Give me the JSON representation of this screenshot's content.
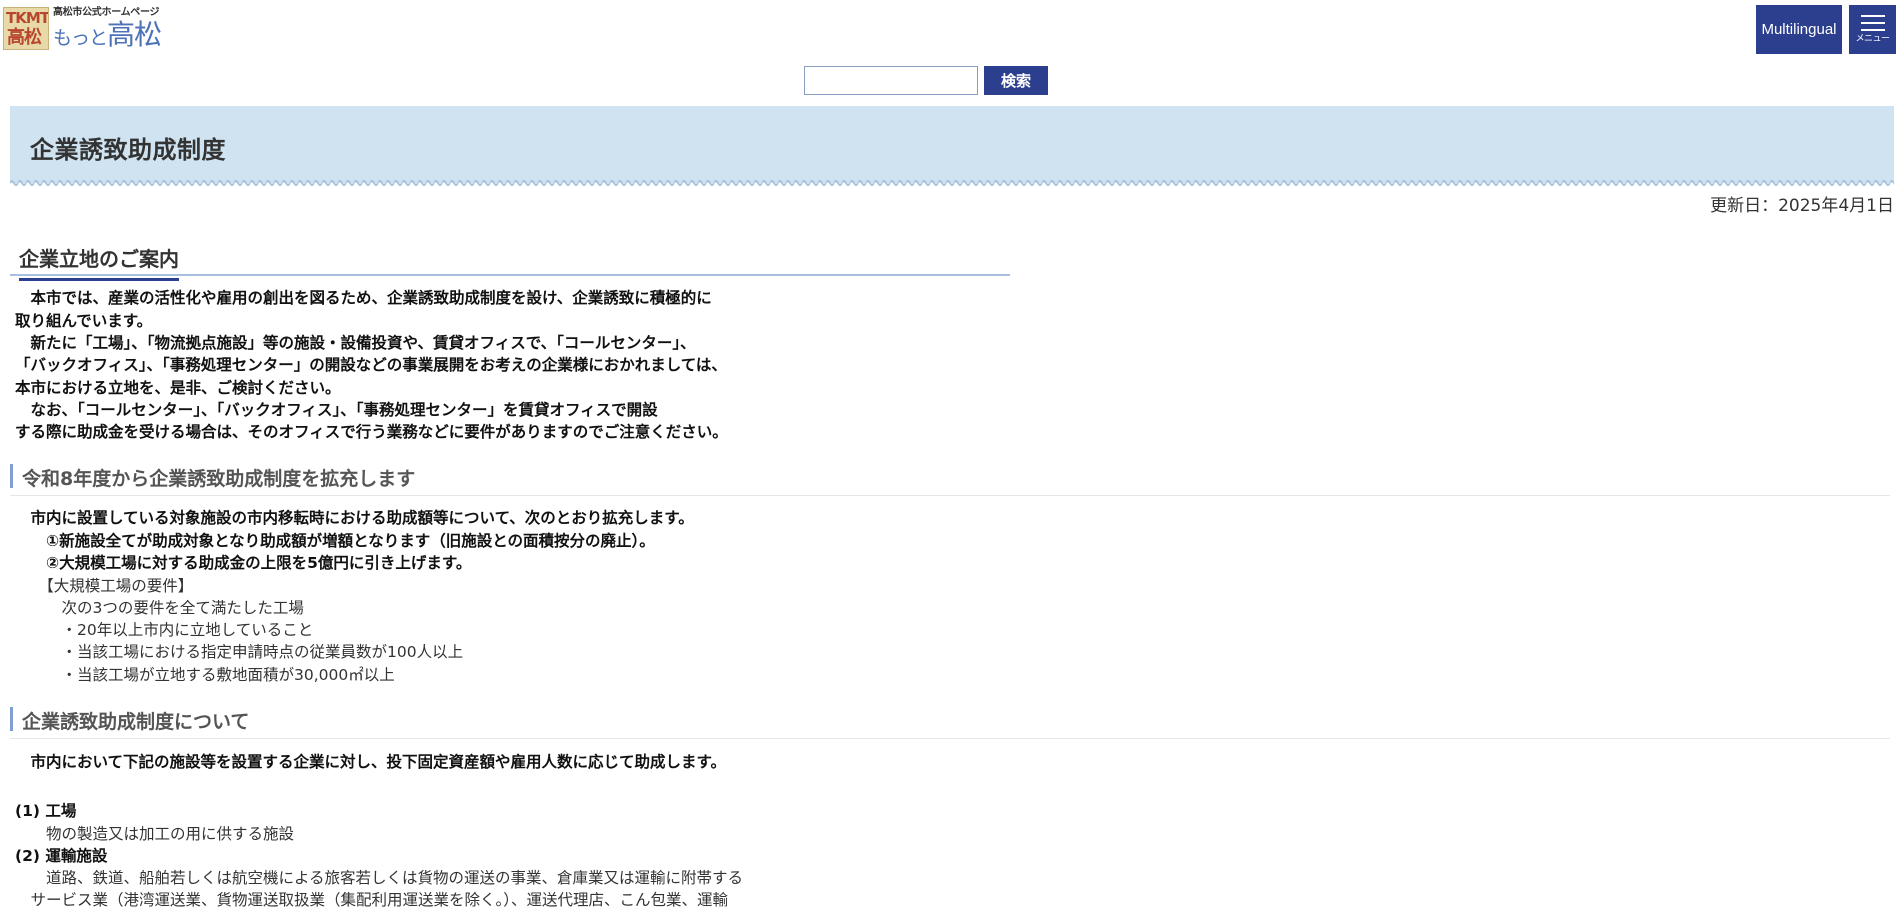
{
  "header": {
    "logo": {
      "mark_line1": "TKMT",
      "mark_line2": "高松",
      "subtitle": "高松市公式ホームページ",
      "title_small": "もっと",
      "title_large": "高松"
    },
    "multilingual_label": "Multilingual",
    "menu_label": "メニュー"
  },
  "search": {
    "placeholder": "",
    "button_label": "検索"
  },
  "page": {
    "title": "企業誘致助成制度",
    "updated": "更新日：2025年4月1日"
  },
  "section_intro": {
    "heading": "企業立地のご案内",
    "lines": [
      "　本市では、産業の活性化や雇用の創出を図るため、企業誘致助成制度を設け、企業誘致に積極的に",
      "取り組んでいます。",
      "　新たに「工場」、「物流拠点施設」等の施設・設備投資や、賃貸オフィスで、「コールセンター」、",
      "「バックオフィス」、「事務処理センター」の開設などの事業展開をお考えの企業様におかれましては、",
      "本市における立地を、是非、ご検討ください。",
      "　なお、「コールセンター」、「バックオフィス」、「事務処理センター」を賃貸オフィスで開設",
      "する際に助成金を受ける場合は、そのオフィスで行う業務などに要件がありますのでご注意ください。"
    ]
  },
  "section_expansion": {
    "heading": "令和8年度から企業誘致助成制度を拡充します",
    "bold_lines": [
      "　市内に設置している対象施設の市内移転時における助成額等について、次のとおり拡充します。",
      "　　①新施設全てが助成対象となり助成額が増額となります（旧施設との面積按分の廃止）。",
      "　　②大規模工場に対する助成金の上限を5億円に引き上げます。"
    ],
    "normal_lines": [
      "　　【大規模工場の要件】",
      "　　　次の3つの要件を全て満たした工場",
      "　　　・20年以上市内に立地していること",
      "　　　・当該工場における指定申請時点の従業員数が100人以上",
      "　　　・当該工場が立地する敷地面積が30,000㎡以上"
    ]
  },
  "section_about": {
    "heading": "企業誘致助成制度について",
    "intro": "　市内において下記の施設等を設置する企業に対し、投下固定資産額や雇用人数に応じて助成します。",
    "items": [
      {
        "label": "(1) 工場",
        "desc": "　　物の製造又は加工の用に供する施設"
      },
      {
        "label": "(2) 運輸施設",
        "desc": "　　道路、鉄道、船舶若しくは航空機による旅客若しくは貨物の運送の事業、倉庫業又は運輸に附帯する"
      }
    ],
    "continuation": "　サービス業（港湾運送業、貨物運送取扱業（集配利用運送業を除く。）、運送代理店、こん包業、運輸"
  }
}
